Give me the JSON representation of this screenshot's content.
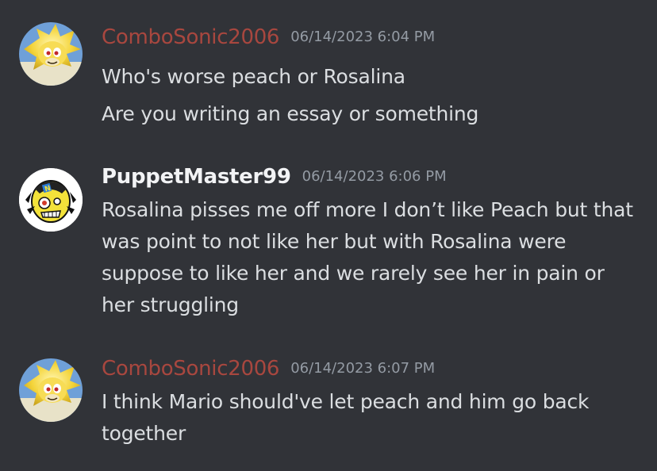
{
  "colors": {
    "background": "#313338",
    "username_combo": "#a8473f",
    "username_puppet": "#f2f3f5",
    "timestamp": "#949ba4",
    "message_text": "#dbdee1"
  },
  "messages": [
    {
      "author": "ComboSonic2006",
      "timestamp": "06/14/2023 6:04 PM",
      "avatar_icon": "super-sonic-avatar",
      "lines": [
        "Who's worse peach or Rosalina",
        "Are you writing an essay or something"
      ]
    },
    {
      "author": "PuppetMaster99",
      "timestamp": "06/14/2023 6:06 PM",
      "avatar_icon": "neo-cortex-avatar",
      "text": "Rosalina pisses me off more I don’t like Peach but that was point to not like her but with Rosalina were suppose to like her and we rarely see her in pain or her struggling"
    },
    {
      "author": "ComboSonic2006",
      "timestamp": "06/14/2023 6:07 PM",
      "avatar_icon": "super-sonic-avatar",
      "text": "I think Mario should've let peach and him go back together"
    }
  ]
}
